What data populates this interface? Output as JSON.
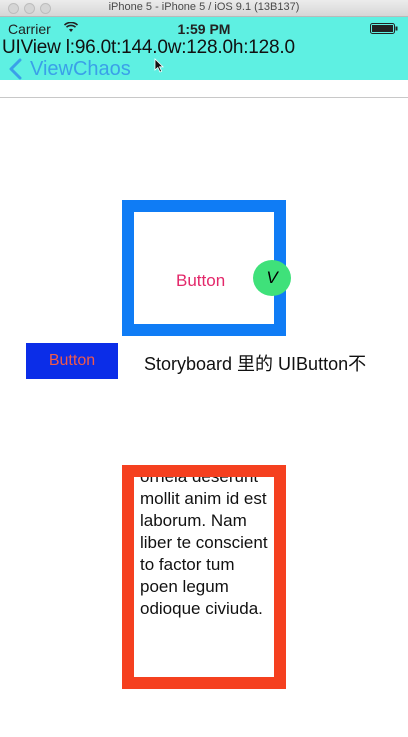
{
  "window": {
    "title": "iPhone 5 - iPhone 5 / iOS 9.1 (13B137)"
  },
  "status_bar": {
    "carrier": "Carrier",
    "time": "1:59 PM"
  },
  "debug_overlay": {
    "text": "UIView l:96.0t:144.0w:128.0h:128.0"
  },
  "nav": {
    "back_label": "ViewChaos"
  },
  "content": {
    "center_button": "Button",
    "badge": "V",
    "left_button": "Button",
    "storyboard_label": "Storyboard 里的 UIButton不",
    "lorem_text": "ornela deserunt mollit anim id est laborum. Nam liber te conscient to factor tum poen legum odioque civiuda."
  },
  "colors": {
    "teal": "#5ef0e2",
    "blue_frame": "#0f7cf5",
    "red_frame": "#f5401f",
    "badge_green": "#3fe17a",
    "left_button_bg": "#0b2de8",
    "button_text_pink": "#e3286a"
  }
}
